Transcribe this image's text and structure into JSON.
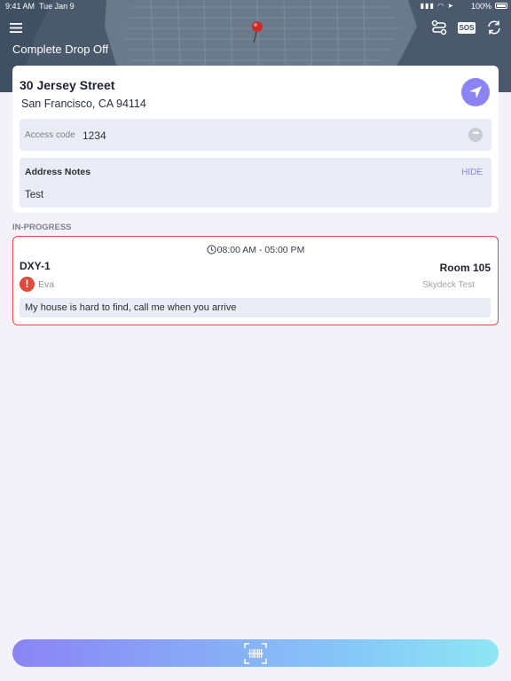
{
  "status_bar": {
    "time": "9:41 AM",
    "date": "Tue Jan 9",
    "battery": "100%"
  },
  "header": {
    "title": "Complete Drop Off",
    "buttons": [
      {
        "icon": "hamburger-menu-icon"
      },
      {
        "icon": "route-icon"
      },
      {
        "icon": "sos-icon",
        "label": "SOS"
      },
      {
        "icon": "refresh-icon"
      }
    ],
    "map_pin_color": "#cc2a2a"
  },
  "address": {
    "street": "30 Jersey Street",
    "city_line": "San Francisco, CA 94114",
    "navigate_icon": "navigation-arrow-icon",
    "access_label": "Access code",
    "access_value": "1234",
    "notes_label": "Address Notes",
    "notes_toggle": "HIDE",
    "notes_text": "Test"
  },
  "section": {
    "label": "IN-PROGRESS"
  },
  "stop": {
    "time_window": "08:00 AM - 05:00 PM",
    "id": "DXY-1",
    "room": "Room 105",
    "alert_symbol": "!",
    "contact": "Eva",
    "company": "Skydeck Test",
    "note": "My house is hard to find, call me when you arrive",
    "border_color": "#e04a3c"
  },
  "bottom": {
    "scan_icon": "barcode-scan-icon"
  },
  "colors": {
    "accent": "#8a84f5",
    "background": "#f2f2f8",
    "alert": "#e04a3c"
  }
}
